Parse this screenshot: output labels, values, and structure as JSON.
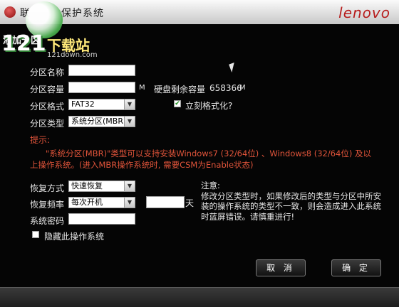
{
  "window": {
    "title_prefix": "联",
    "title_suffix": "保护系统",
    "brand": "lenovo"
  },
  "watermark": {
    "number": "121",
    "chinese": "下载站",
    "url": "121down.com"
  },
  "section": {
    "title": "添加分区"
  },
  "form": {
    "partition_name": {
      "label": "分区名称",
      "value": ""
    },
    "partition_size": {
      "label": "分区容量",
      "value": "",
      "unit": "M"
    },
    "free_space": {
      "label": "硬盘剩余容量",
      "value": "658366",
      "unit": "M"
    },
    "partition_format": {
      "label": "分区格式",
      "selected": "FAT32"
    },
    "format_now": {
      "label": "立刻格式化?",
      "checked": true
    },
    "partition_type": {
      "label": "分区类型",
      "selected": "系统分区(MBR)"
    },
    "restore_mode": {
      "label": "恢复方式",
      "selected": "快速恢复"
    },
    "restore_freq": {
      "label": "恢复频率",
      "selected": "每次开机",
      "days_value": "",
      "days_unit": "天"
    },
    "system_password": {
      "label": "系统密码",
      "value": ""
    },
    "hide_os": {
      "label": "隐藏此操作系统",
      "checked": false
    }
  },
  "hint": {
    "title": "提示:",
    "body": "\"系统分区(MBR)\"类型可以支持安装Windows7 (32/64位) 、Windows8 (32/64位) 及以上操作系统。(进入MBR操作系统时, 需要CSM为Enable状态)"
  },
  "note": {
    "title": "注意:",
    "body": "修改分区类型时，如果修改后的类型与分区中所安装的操作系统的类型不一致，则会造成进入此系统时蓝屏错误。请慎重进行!"
  },
  "buttons": {
    "cancel": "取 消",
    "ok": "确 定"
  },
  "colors": {
    "accent_red": "#e0543a",
    "brand_red": "#b71c1c",
    "background": "#050505"
  }
}
